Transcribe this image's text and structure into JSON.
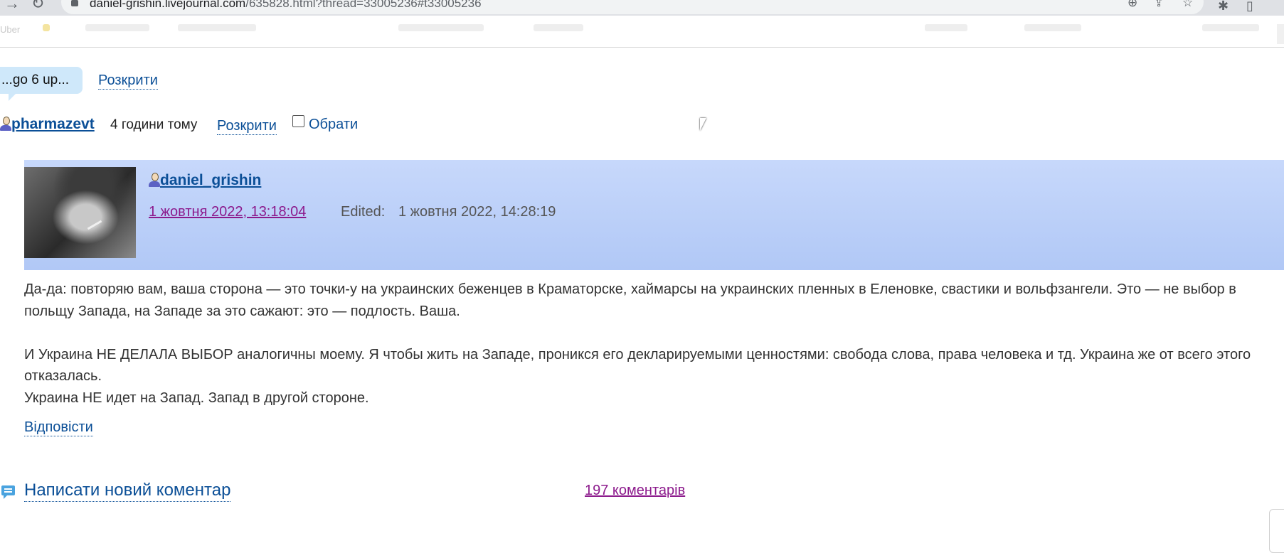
{
  "browser": {
    "url_host": "daniel-grishin.livejournal.com",
    "url_path": "/635828.html?thread=33005236#t33005236",
    "bookmark_first": "Uber"
  },
  "thread": {
    "bubble_text": "...go 6 up...",
    "expand_label": "Розкрити"
  },
  "parent_meta": {
    "username": "pharmazevt",
    "time_ago": "4 години тому",
    "expand_label": "Розкрити",
    "select_label": "Обрати",
    "selected": false
  },
  "comment": {
    "username": "daniel_grishin",
    "date": "1 жовтня 2022, 13:18:04",
    "edited_label": "Edited:",
    "edited_value": "1 жовтня 2022, 14:28:19",
    "paragraph1": "Да-да: повторяю вам, ваша сторона — это точки-у на украинских беженцев в Краматорске, хаймарсы на украинских пленных в Еленовке, свастики и вольфзангели. Это — не выбор в польщу Запада, на Западе за это сажают: это — подлость. Ваша.",
    "paragraph2": "И Украина НЕ ДЕЛАЛА ВЫБОР аналогичны моему. Я чтобы жить на Западе, проникся его декларируемыми ценностями: свобода слова, права человека и тд. Украина же от всего этого отказалась.",
    "paragraph3": "Украина НЕ идет на Запад. Запад в другой стороне.",
    "reply_label": "Відповісти"
  },
  "footer": {
    "new_comment_label": "Написати новий коментар",
    "comments_count_label": "197 коментарів"
  },
  "colors": {
    "link": "#0b4f97",
    "visited_link": "#8c1a8c",
    "header_bg": "#c7d8fb",
    "bubble_bg": "#cfe8fa"
  }
}
